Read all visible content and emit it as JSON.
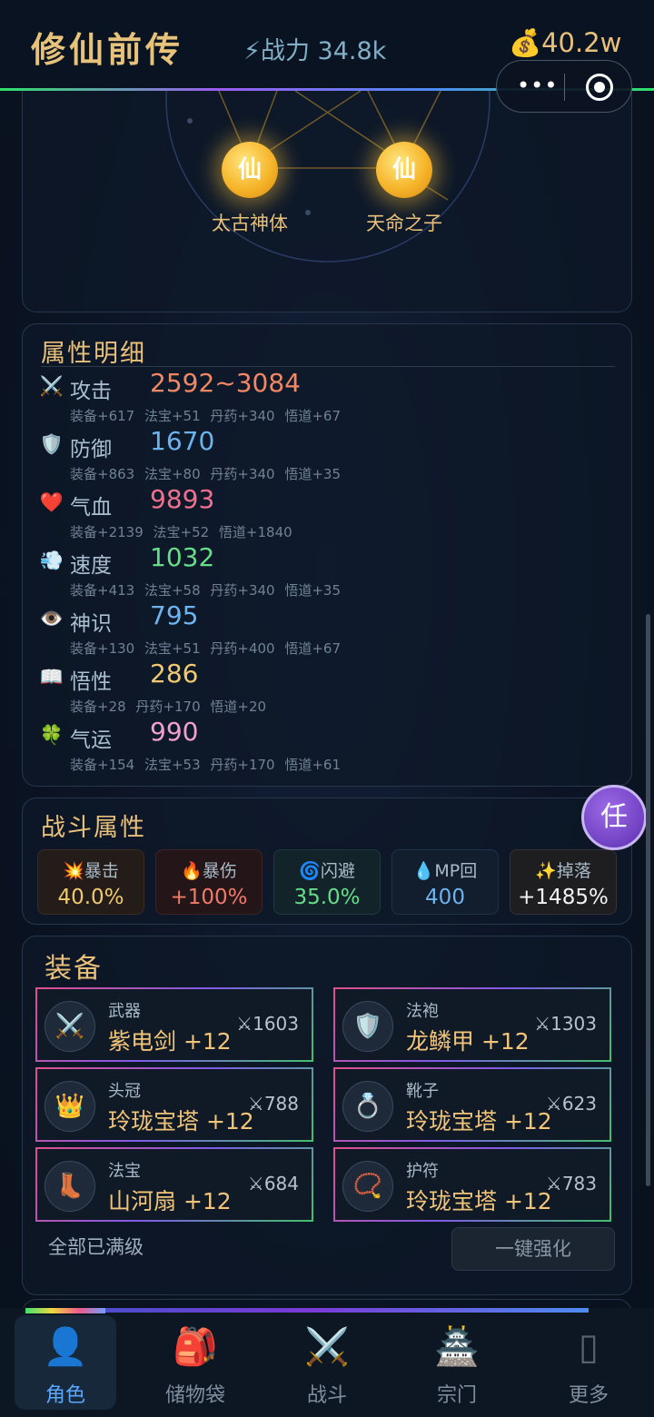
{
  "header": {
    "title": "修仙前传",
    "power_label": "⚡战力 34.8k",
    "money_label": "💰40.2w",
    "menu_dots": "•••"
  },
  "talents": [
    {
      "orb_char": "仙",
      "name": "太古神体"
    },
    {
      "orb_char": "仙",
      "name": "天命之子"
    }
  ],
  "attributes": {
    "title": "属性明细",
    "rows": [
      {
        "icon": "⚔️",
        "name": "攻击",
        "value": "2592~3084",
        "color": "#f08866",
        "detail": "装备+617 法宝+51 丹药+340 悟道+67"
      },
      {
        "icon": "🛡️",
        "name": "防御",
        "value": "1670",
        "color": "#6cb4ee",
        "detail": "装备+863 法宝+80 丹药+340 悟道+35"
      },
      {
        "icon": "❤️",
        "name": "气血",
        "value": "9893",
        "color": "#f07090",
        "detail": "装备+2139 法宝+52 悟道+1840"
      },
      {
        "icon": "💨",
        "name": "速度",
        "value": "1032",
        "color": "#66dd88",
        "detail": "装备+413 法宝+58 丹药+340 悟道+35"
      },
      {
        "icon": "👁️",
        "name": "神识",
        "value": "795",
        "color": "#6cb4ee",
        "detail": "装备+130 法宝+51 丹药+400 悟道+67"
      },
      {
        "icon": "📖",
        "name": "悟性",
        "value": "286",
        "color": "#f0c870",
        "detail": "装备+28 丹药+170 悟道+20"
      },
      {
        "icon": "🍀",
        "name": "气运",
        "value": "990",
        "color": "#f0a0d0",
        "detail": "装备+154 法宝+53 丹药+170 悟道+61"
      }
    ]
  },
  "battle": {
    "title": "战斗属性",
    "stats": [
      {
        "label": "💥暴击",
        "value": "40.0%",
        "color": "#f0c870",
        "bg": "#231c18",
        "border": "#3a2c22"
      },
      {
        "label": "🔥暴伤",
        "value": "+100%",
        "color": "#f07a6a",
        "bg": "#241618",
        "border": "#3b2326"
      },
      {
        "label": "🌀闪避",
        "value": "35.0%",
        "color": "#66dd88",
        "bg": "#12242a",
        "border": "#1f3a3e"
      },
      {
        "label": "💧MP回",
        "value": "400",
        "color": "#6cb4ee",
        "bg": "#121d2e",
        "border": "#213049"
      },
      {
        "label": "✨掉落",
        "value": "+1485%",
        "color": "#f2f2f2",
        "bg": "#1e1d20",
        "border": "#34323a"
      }
    ]
  },
  "float_button": "任",
  "equipment": {
    "title": "装备",
    "items": [
      {
        "icon": "⚔️",
        "slot": "武器",
        "name": "紫电剑 +12",
        "power": "⚔1603"
      },
      {
        "icon": "🛡️",
        "slot": "法袍",
        "name": "龙鳞甲 +12",
        "power": "⚔1303"
      },
      {
        "icon": "👑",
        "slot": "头冠",
        "name": "玲珑宝塔 +12",
        "power": "⚔788"
      },
      {
        "icon": "💍",
        "slot": "靴子",
        "name": "玲珑宝塔 +12",
        "power": "⚔623"
      },
      {
        "icon": "👢",
        "slot": "法宝",
        "name": "山河扇 +12",
        "power": "⚔684"
      },
      {
        "icon": "📿",
        "slot": "护符",
        "name": "玲珑宝塔 +12",
        "power": "⚔783"
      }
    ],
    "all_max_label": "全部已满级",
    "strengthen_label": "一键强化"
  },
  "tabs": [
    {
      "icon": "👤",
      "label": "角色",
      "active": true
    },
    {
      "icon": "🎒",
      "label": "储物袋",
      "active": false
    },
    {
      "icon": "⚔️",
      "label": "战斗",
      "active": false
    },
    {
      "icon": "🏯",
      "label": "宗门",
      "active": false
    },
    {
      "icon": "▯",
      "label": "更多",
      "active": false
    }
  ]
}
